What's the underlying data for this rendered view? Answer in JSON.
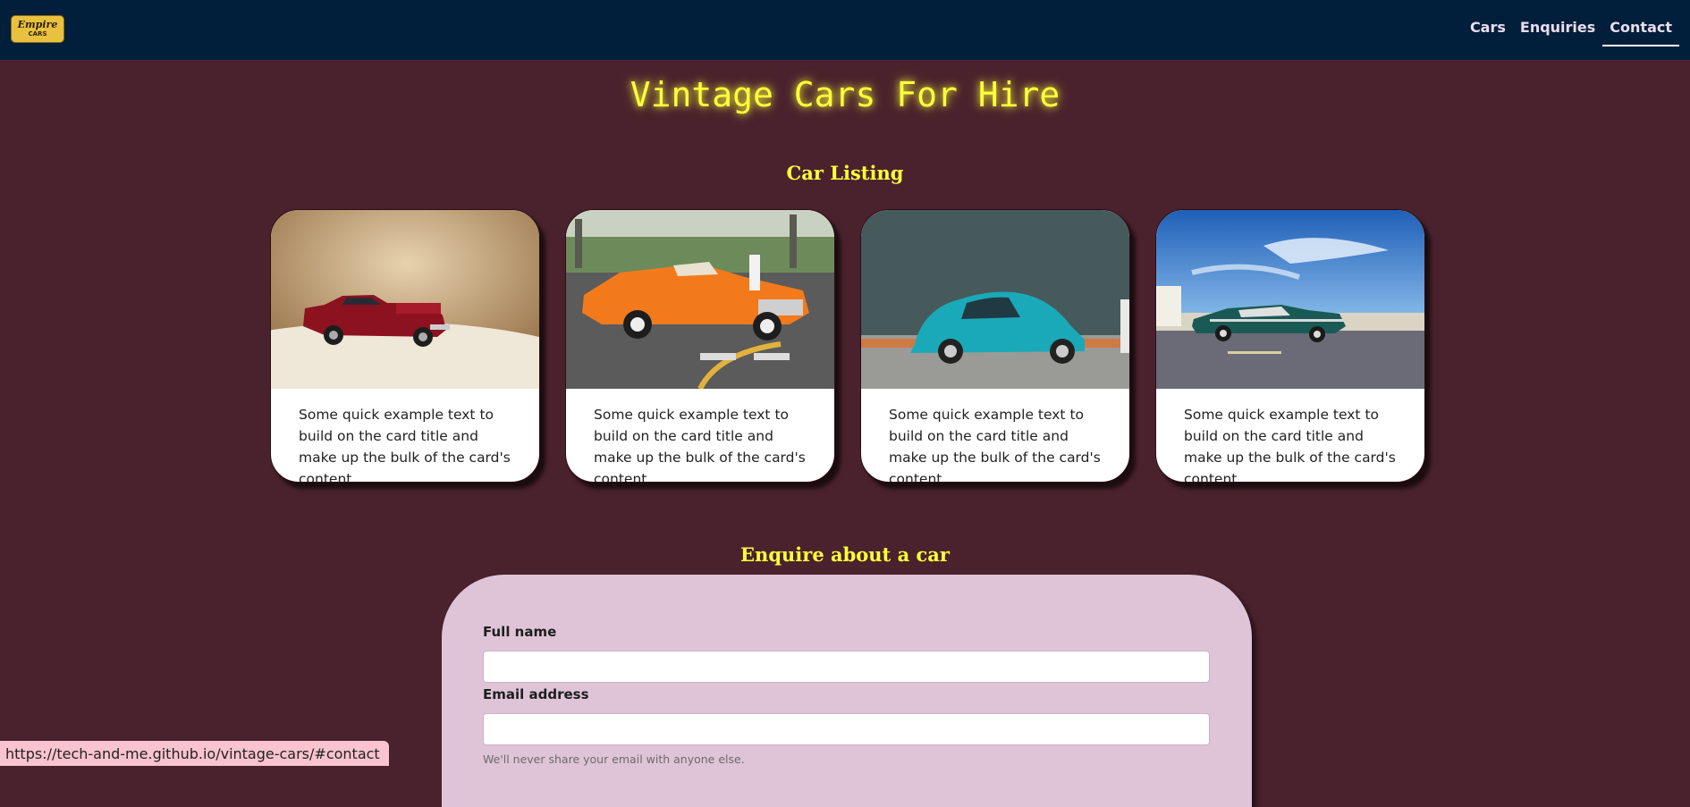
{
  "navbar": {
    "logo_line1": "Empire",
    "logo_line2": "CARS",
    "links": [
      {
        "label": "Cars"
      },
      {
        "label": "Enquiries"
      },
      {
        "label": "Contact"
      }
    ],
    "active_link": "Contact"
  },
  "hero": {
    "title": "Vintage Cars For Hire"
  },
  "listing": {
    "heading": "Car Listing",
    "cards": [
      {
        "image": "red vintage pickup model car",
        "text": "Some quick example text to build on the card title and make up the bulk of the card's content."
      },
      {
        "image": "orange vintage convertible on street",
        "text": "Some quick example text to build on the card title and make up the bulk of the card's content."
      },
      {
        "image": "turquoise vintage beetle",
        "text": "Some quick example text to build on the card title and make up the bulk of the card's content."
      },
      {
        "image": "teal vintage sedan by the sea",
        "text": "Some quick example text to build on the card title and make up the bulk of the card's content."
      }
    ]
  },
  "enquiry": {
    "heading": "Enquire about a car",
    "full_name_label": "Full name",
    "full_name_value": "",
    "email_label": "Email address",
    "email_value": "",
    "email_help": "We'll never share your email with anyone else."
  },
  "status_bar": {
    "url": "https://tech-and-me.github.io/vintage-cars/#contact"
  },
  "colors": {
    "navbar_bg": "#011e3a",
    "page_bg": "#4a222d",
    "heading_yellow": "#ffff3a",
    "form_bg": "#dfc4d8",
    "logo_gold": "#e8c23e"
  }
}
